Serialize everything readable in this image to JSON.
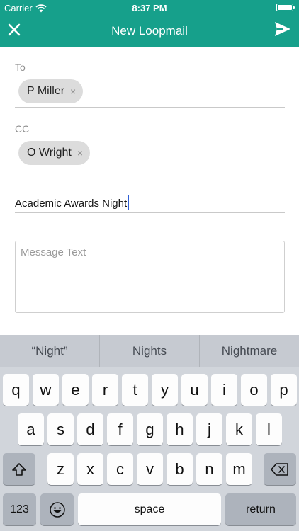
{
  "status_bar": {
    "carrier": "Carrier",
    "time": "8:37 PM"
  },
  "nav": {
    "title": "New Loopmail",
    "close_icon": "close-icon",
    "send_icon": "send-icon"
  },
  "form": {
    "to_label": "To",
    "to_chips": [
      "P Miller"
    ],
    "cc_label": "CC",
    "cc_chips": [
      "O Wright"
    ],
    "chip_remove": "×",
    "subject_value": "Academic Awards Night",
    "message_placeholder": "Message Text"
  },
  "keyboard": {
    "suggestions": [
      "“Night”",
      "Nights",
      "Nightmare"
    ],
    "row1": [
      "q",
      "w",
      "e",
      "r",
      "t",
      "y",
      "u",
      "i",
      "o",
      "p"
    ],
    "row2": [
      "a",
      "s",
      "d",
      "f",
      "g",
      "h",
      "j",
      "k",
      "l"
    ],
    "row3": [
      "z",
      "x",
      "c",
      "v",
      "b",
      "n",
      "m"
    ],
    "numbers": "123",
    "space": "space",
    "return": "return"
  }
}
